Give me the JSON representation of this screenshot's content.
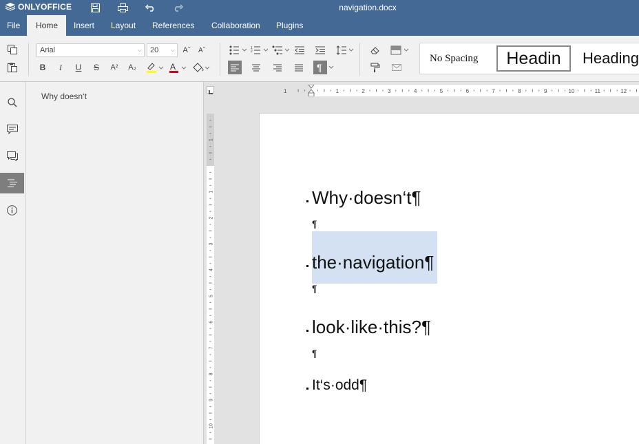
{
  "titlebar": {
    "app_name": "ONLYOFFICE",
    "document_title": "navigation.docx"
  },
  "tabs": [
    {
      "label": "File"
    },
    {
      "label": "Home"
    },
    {
      "label": "Insert"
    },
    {
      "label": "Layout"
    },
    {
      "label": "References"
    },
    {
      "label": "Collaboration"
    },
    {
      "label": "Plugins"
    }
  ],
  "active_tab": "Home",
  "toolbar": {
    "font_name": "Arial",
    "font_size": "20",
    "bold": "B",
    "italic": "I",
    "underline": "U",
    "strike": "S",
    "superscript": "A²",
    "subscript": "A₂",
    "font_color_letter": "A",
    "grow_font": "Aˆ",
    "shrink_font": "Aˇ"
  },
  "styles": [
    {
      "label": "No Spacing"
    },
    {
      "label": "Headin"
    },
    {
      "label": "Heading"
    }
  ],
  "navigation": {
    "items": [
      {
        "label": "Why doesn‘t"
      }
    ]
  },
  "document": {
    "paragraphs": [
      {
        "text": "Why·doesn‘t¶"
      },
      {
        "text": "the·navigation¶"
      },
      {
        "text": "look·like·this?¶"
      },
      {
        "text": "It‘s·odd¶"
      }
    ],
    "empty_mark": "¶"
  },
  "ruler": {
    "h_labels": [
      "1",
      "1",
      "2",
      "3",
      "4",
      "5",
      "6",
      "7",
      "8",
      "9",
      "10",
      "11",
      "12"
    ],
    "v_labels": [
      "1",
      "1",
      "2",
      "3",
      "4",
      "5",
      "6",
      "7",
      "8",
      "9",
      "10"
    ]
  },
  "colors": {
    "brand": "#446995",
    "selection": "#d4e1f3",
    "highlight": "#ffff00",
    "font_color": "#e0001b"
  }
}
